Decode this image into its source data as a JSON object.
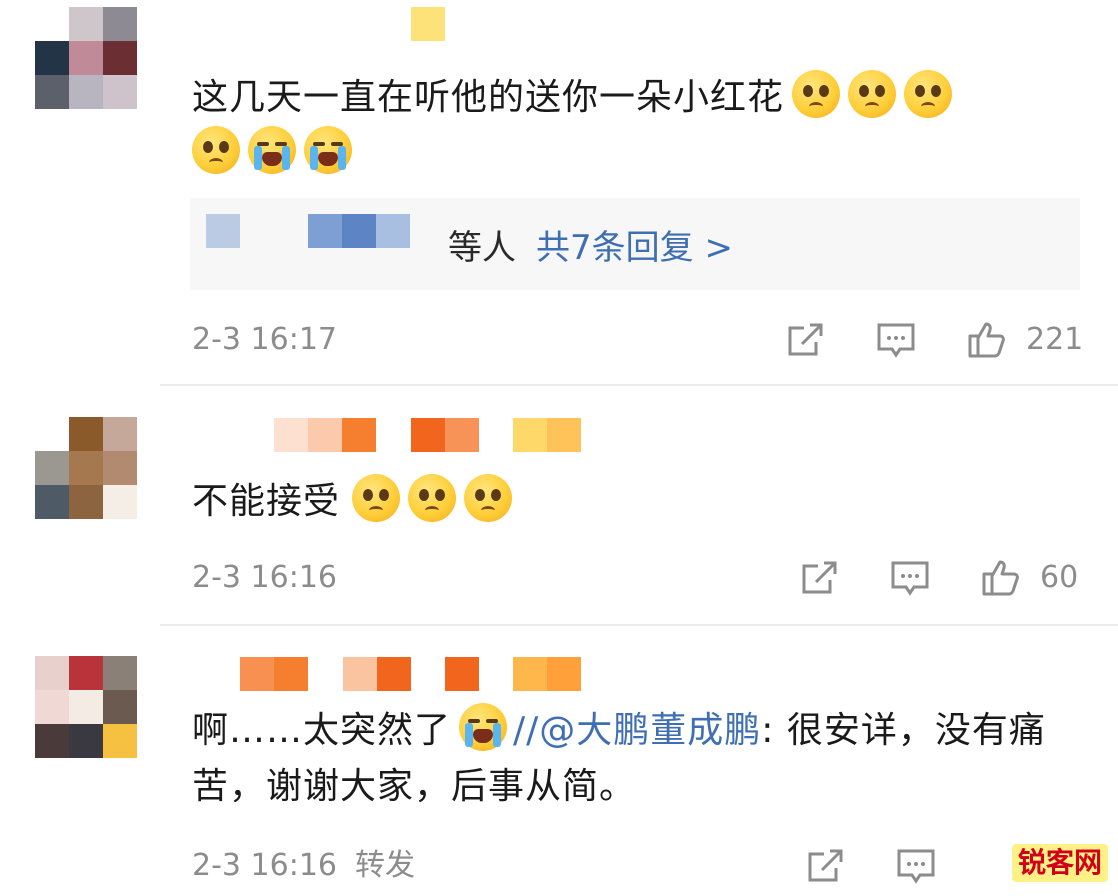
{
  "comments": [
    {
      "text": "这几天一直在听他的送你一朵小红花",
      "emojis": [
        "sad-face-icon",
        "sad-face-icon",
        "sad-face-icon",
        "sad-face-icon",
        "crying-face-icon",
        "crying-face-icon"
      ],
      "reply_summary": {
        "suffix": "等人",
        "link": "共7条回复 >"
      },
      "time": "2-3 16:17",
      "likes": "221"
    },
    {
      "text": "不能接受",
      "emojis": [
        "sad-face-icon",
        "sad-face-icon",
        "sad-face-icon"
      ],
      "time": "2-3 16:16",
      "likes": "60"
    },
    {
      "text_before": "啊……太突然了",
      "emoji": "crying-face-icon",
      "text_slashes": "//",
      "mention": "@大鹏董成鹏",
      "text_after": ": 很安详，没有痛苦，谢谢大家，后事从简。",
      "time": "2-3 16:16",
      "forward_label": "转发"
    }
  ],
  "watermark": "锐客网",
  "colors": {
    "link": "#3f6fb3",
    "meta": "#8c8c8c",
    "reply_bg": "#f7f7f7"
  }
}
